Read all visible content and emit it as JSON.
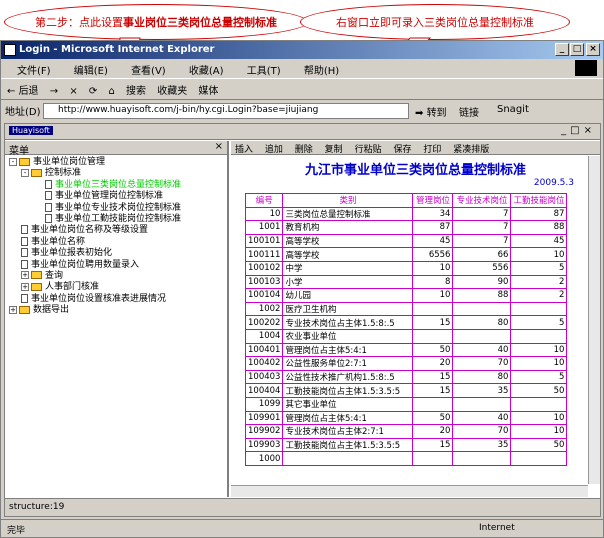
{
  "callouts": {
    "left_prefix": "第二步：点此设置",
    "left_bold": "事业岗位三类岗位总量控制标准",
    "right": "右窗口立即可录入三类岗位总量控制标准"
  },
  "window": {
    "title": "Login - Microsoft Internet Explorer",
    "controls": [
      "_",
      "□",
      "×"
    ]
  },
  "menu": [
    "文件(F)",
    "编辑(E)",
    "查看(V)",
    "收藏(A)",
    "工具(T)",
    "帮助(H)"
  ],
  "toolbar": [
    "后退",
    "→",
    "×",
    "⟳",
    "⌂",
    "搜索",
    "收藏夹",
    "媒体"
  ],
  "address": {
    "label": "地址(D)",
    "value": "http://www.huayisoft.com/j-bin/hy.cgi.Login?base=jiujiang",
    "go": "转到",
    "links": "链接",
    "snagit": "Snagit"
  },
  "app": {
    "logo": "Huayisoft",
    "left_head": "菜单",
    "tree": [
      {
        "label": "事业单位岗位管理",
        "kind": "folder",
        "pm": "-",
        "indent": 0
      },
      {
        "label": "控制标准",
        "kind": "folder",
        "pm": "-",
        "indent": 1
      },
      {
        "label": "事业单位三类岗位总量控制标准",
        "kind": "doc",
        "indent": 3,
        "active": true
      },
      {
        "label": "事业单位管理岗位控制标准",
        "kind": "doc",
        "indent": 3
      },
      {
        "label": "事业单位专业技术岗位控制标准",
        "kind": "doc",
        "indent": 3
      },
      {
        "label": "事业单位工勤技能岗位控制标准",
        "kind": "doc",
        "indent": 3
      },
      {
        "label": "事业单位岗位名称及等级设置",
        "kind": "doc",
        "indent": 1
      },
      {
        "label": "事业单位名称",
        "kind": "doc",
        "indent": 1
      },
      {
        "label": "事业单位报表初始化",
        "kind": "doc",
        "indent": 1
      },
      {
        "label": "事业单位岗位聘用数量录入",
        "kind": "doc",
        "indent": 1
      },
      {
        "label": "查询",
        "kind": "folder",
        "pm": "+",
        "indent": 1
      },
      {
        "label": "人事部门核准",
        "kind": "folder",
        "pm": "+",
        "indent": 1
      },
      {
        "label": "事业单位岗位设置核准表进展情况",
        "kind": "doc",
        "indent": 1
      },
      {
        "label": "数据导出",
        "kind": "folder",
        "pm": "+",
        "indent": 0
      }
    ],
    "right_toolbar": [
      "插入",
      "追加",
      "删除",
      "复制",
      "行粘贴",
      "保存",
      "打印",
      "紧凑排版"
    ],
    "report_title": "九江市事业单位三类岗位总量控制标准",
    "report_date": "2009.5.3",
    "table": {
      "headers": [
        "编号",
        "类别",
        "管理岗位",
        "专业技术岗位",
        "工勤技能岗位"
      ],
      "rows": [
        [
          "10",
          "三类岗位总量控制标准",
          "34",
          "7",
          "87"
        ],
        [
          "1001",
          "教育机构",
          "87",
          "7",
          "88"
        ],
        [
          "100101",
          "高等学校",
          "45",
          "7",
          "45"
        ],
        [
          "100111",
          "高等学校",
          "6556",
          "66",
          "10"
        ],
        [
          "100102",
          "中学",
          "10",
          "556",
          "5"
        ],
        [
          "100103",
          "小学",
          "8",
          "90",
          "2"
        ],
        [
          "100104",
          "幼儿园",
          "10",
          "88",
          "2"
        ],
        [
          "1002",
          "医疗卫生机构",
          "",
          "",
          ""
        ],
        [
          "100202",
          "专业技术岗位占主体1.5:8:.5",
          "15",
          "80",
          "5"
        ],
        [
          "1004",
          "农业事业单位",
          "",
          "",
          ""
        ],
        [
          "100401",
          "管理岗位占主体5:4:1",
          "50",
          "40",
          "10"
        ],
        [
          "100402",
          "公益性服务单位2:7:1",
          "20",
          "70",
          "10"
        ],
        [
          "100403",
          "公益性技术推广机构1.5:8:.5",
          "15",
          "80",
          "5"
        ],
        [
          "100404",
          "工勤技能岗位占主体1.5:3.5:5",
          "15",
          "35",
          "50"
        ],
        [
          "1099",
          "其它事业单位",
          "",
          "",
          ""
        ],
        [
          "109901",
          "管理岗位占主体5:4:1",
          "50",
          "40",
          "10"
        ],
        [
          "109902",
          "专业技术岗位占主体2:7:1",
          "20",
          "70",
          "10"
        ],
        [
          "109903",
          "工勤技能岗位占主体1.5:3.5:5",
          "15",
          "35",
          "50"
        ],
        [
          "1000",
          "",
          "",
          "",
          ""
        ]
      ]
    },
    "structure": "structure:19"
  },
  "status": {
    "left": "完毕",
    "zone": "Internet"
  }
}
